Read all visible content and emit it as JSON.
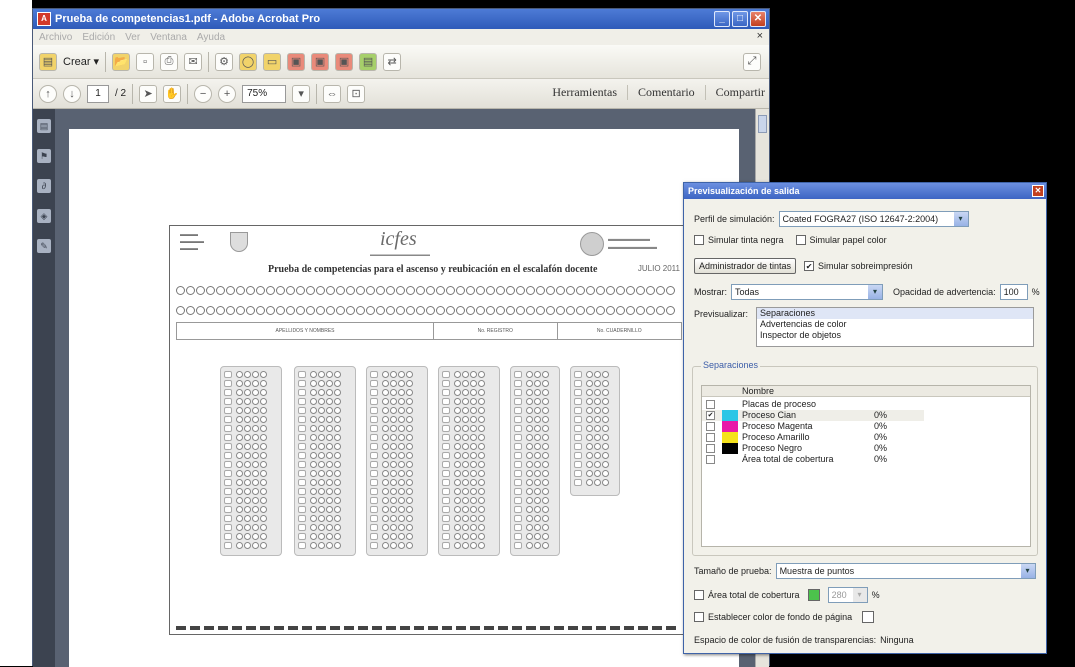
{
  "window": {
    "title": "Prueba de competencias1.pdf - Adobe Acrobat Pro",
    "menu": [
      "Archivo",
      "Edición",
      "Ver",
      "Ventana",
      "Ayuda"
    ]
  },
  "toolbar": {
    "crear_label": "Crear",
    "page_current": "1",
    "page_total": "/ 2",
    "zoom": "75%",
    "right_links": [
      "Herramientas",
      "Comentario",
      "Compartir"
    ]
  },
  "document": {
    "form_heading": "Prueba de competencias para el ascenso y reubicación en el escalafón docente",
    "form_date": "JULIO 2011",
    "logo_text": "icfes",
    "column_labels": [
      "APELLIDOS Y NOMBRES",
      "No. REGISTRO",
      "No. CUADERNILLO"
    ]
  },
  "dialog": {
    "title": "Previsualización de salida",
    "perfil_label": "Perfil de simulación:",
    "perfil_value": "Coated FOGRA27 (ISO 12647-2:2004)",
    "simular_tinta_negra": "Simular tinta negra",
    "simular_papel_color": "Simular papel color",
    "administrador_btn": "Administrador de tintas",
    "simular_sobreimpresion": "Simular sobreimpresión",
    "mostrar_label": "Mostrar:",
    "mostrar_value": "Todas",
    "opacidad_label": "Opacidad de advertencia:",
    "opacidad_value": "100",
    "opacidad_unit": "%",
    "previsualizar_label": "Previsualizar:",
    "previsualizar_options": [
      "Separaciones",
      "Advertencias de color",
      "Inspector de objetos"
    ],
    "separaciones_label": "Separaciones",
    "table_header": "Nombre",
    "separations": [
      {
        "name": "Placas de proceso",
        "pct": "",
        "checked": false,
        "color": ""
      },
      {
        "name": "Proceso Cian",
        "pct": "0%",
        "checked": true,
        "color": "#29c6e6"
      },
      {
        "name": "Proceso Magenta",
        "pct": "0%",
        "checked": false,
        "color": "#e81aa8"
      },
      {
        "name": "Proceso Amarillo",
        "pct": "0%",
        "checked": false,
        "color": "#f5e21c"
      },
      {
        "name": "Proceso Negro",
        "pct": "0%",
        "checked": false,
        "color": "#000000"
      },
      {
        "name": "Área total de cobertura",
        "pct": "0%",
        "checked": false,
        "color": ""
      }
    ],
    "tamano_label": "Tamaño de prueba:",
    "tamano_value": "Muestra de puntos",
    "area_total_label": "Área total de cobertura",
    "area_total_value": "280",
    "area_total_unit": "%",
    "establecer_label": "Establecer color de fondo de página",
    "espacio_label": "Espacio de color de fusión de transparencias:",
    "espacio_value": "Ninguna"
  }
}
